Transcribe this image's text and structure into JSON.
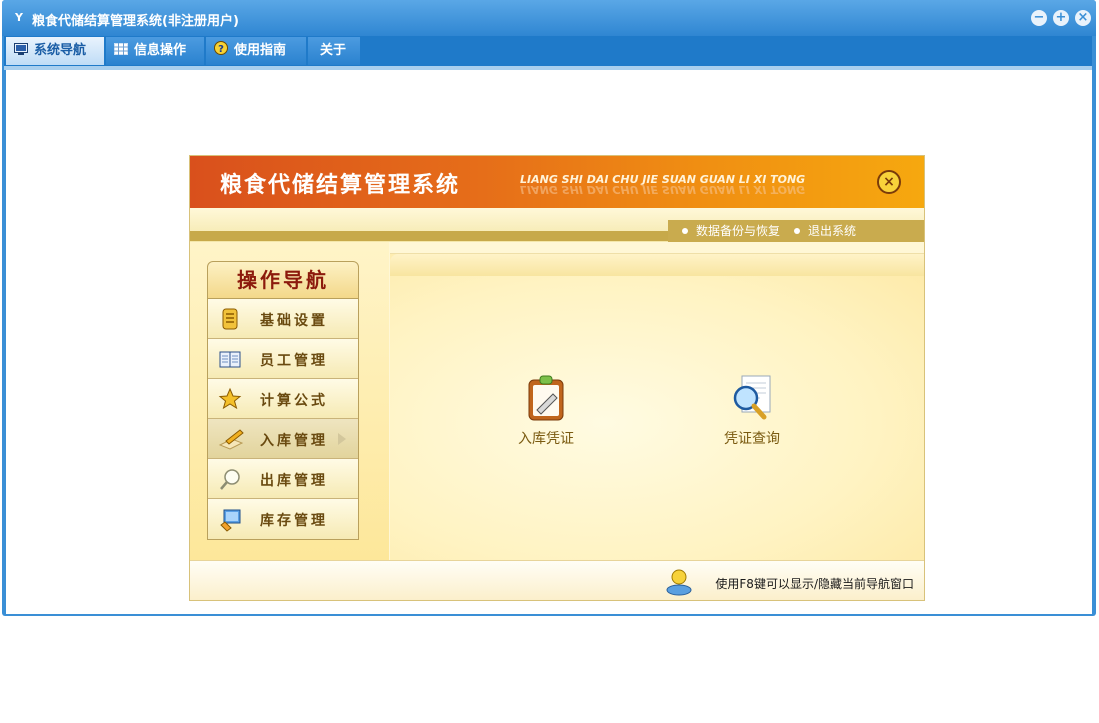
{
  "window": {
    "title": "粮食代储结算管理系统(非注册用户)",
    "app_icon": "Y"
  },
  "menu": {
    "tabs": [
      {
        "label": "系统导航",
        "icon": "monitor-icon",
        "active": true
      },
      {
        "label": "信息操作",
        "icon": "grid-icon",
        "active": false
      },
      {
        "label": "使用指南",
        "icon": "help-icon",
        "active": false
      },
      {
        "label": "关于",
        "icon": "",
        "active": false
      }
    ]
  },
  "banner": {
    "title": "粮食代储结算管理系统",
    "pinyin": "LIANG SHI DAI CHU JIE SUAN GUAN LI XI TONG"
  },
  "sublinks": {
    "backup": "数据备份与恢复",
    "exit": "退出系统"
  },
  "nav": {
    "heading": "操作导航",
    "items": [
      {
        "label": "基础设置",
        "icon": "scroll-icon"
      },
      {
        "label": "员工管理",
        "icon": "book-icon"
      },
      {
        "label": "计算公式",
        "icon": "star-icon"
      },
      {
        "label": "入库管理",
        "icon": "pencil-icon",
        "active": true
      },
      {
        "label": "出库管理",
        "icon": "magnifier-icon"
      },
      {
        "label": "库存管理",
        "icon": "computer-icon"
      }
    ]
  },
  "main": {
    "tiles": [
      {
        "label": "入库凭证",
        "icon": "clipboard-icon"
      },
      {
        "label": "凭证查询",
        "icon": "document-search-icon"
      }
    ]
  },
  "footer": {
    "hint": "使用F8键可以显示/隐藏当前导航窗口"
  },
  "colors": {
    "title_bar": "#3a8fd6",
    "banner_start": "#d9501c",
    "banner_end": "#f6a80f",
    "nav_text": "#6a4a10",
    "heading_text": "#8c1a0c"
  }
}
